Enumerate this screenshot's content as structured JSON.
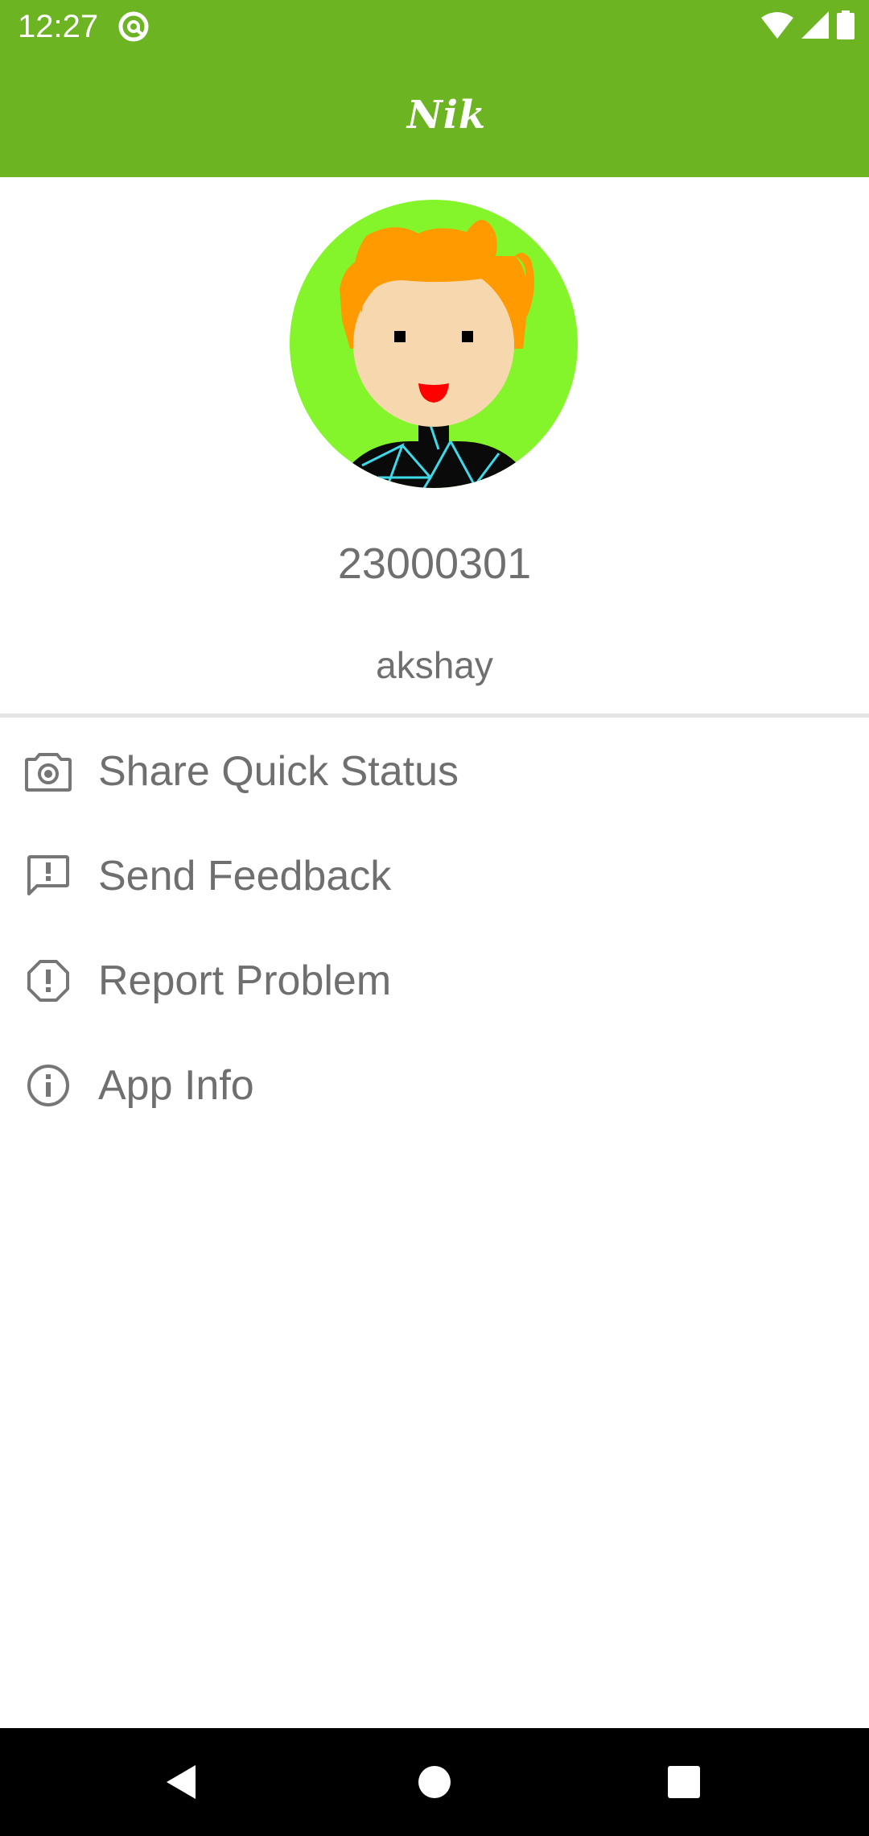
{
  "status_bar": {
    "time": "12:27",
    "icons": [
      "sync-at-icon",
      "wifi-icon",
      "cell-signal-icon",
      "battery-icon"
    ]
  },
  "app_bar": {
    "title": "Nik"
  },
  "profile": {
    "avatar": "cartoon-avatar-orange-hair",
    "id": "23000301",
    "name": "akshay"
  },
  "menu": {
    "items": [
      {
        "label": "Share Quick Status",
        "icon": "camera-icon"
      },
      {
        "label": "Send Feedback",
        "icon": "feedback-icon"
      },
      {
        "label": "Report Problem",
        "icon": "report-icon"
      },
      {
        "label": "App Info",
        "icon": "info-icon"
      }
    ]
  },
  "nav_bar": {
    "buttons": [
      "back-icon",
      "home-icon",
      "recents-icon"
    ]
  },
  "colors": {
    "primary": "#6db423",
    "avatar_bg": "#84f52a",
    "text": "#6f6f6f",
    "icon": "#767676"
  }
}
